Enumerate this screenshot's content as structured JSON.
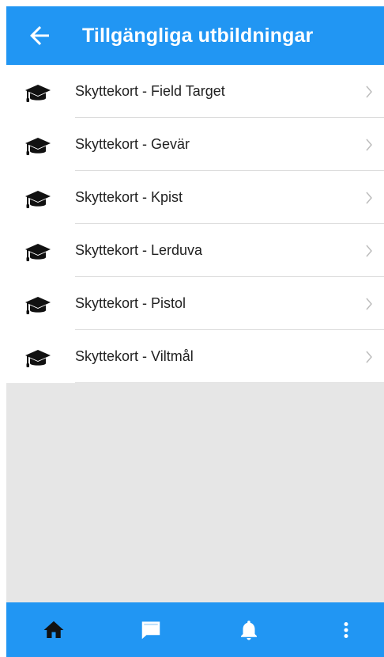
{
  "header": {
    "title": "Tillgängliga utbildningar",
    "back_icon": "arrow-left-icon",
    "color": "#2196f3"
  },
  "courses": [
    {
      "label": "Skyttekort - Field Target",
      "icon": "graduation-cap-icon"
    },
    {
      "label": "Skyttekort - Gevär",
      "icon": "graduation-cap-icon"
    },
    {
      "label": "Skyttekort - Kpist",
      "icon": "graduation-cap-icon"
    },
    {
      "label": "Skyttekort - Lerduva",
      "icon": "graduation-cap-icon"
    },
    {
      "label": "Skyttekort - Pistol",
      "icon": "graduation-cap-icon"
    },
    {
      "label": "Skyttekort - Viltmål",
      "icon": "graduation-cap-icon"
    }
  ],
  "bottom_nav": {
    "items": [
      {
        "icon": "home-icon"
      },
      {
        "icon": "chat-icon"
      },
      {
        "icon": "bell-icon"
      },
      {
        "icon": "more-vertical-icon"
      }
    ]
  },
  "colors": {
    "primary": "#2196f3",
    "background": "#e6e6e6",
    "list_background": "#ffffff",
    "text": "#212121",
    "divider": "#dcdcdc",
    "chevron": "#bdbdbd"
  }
}
